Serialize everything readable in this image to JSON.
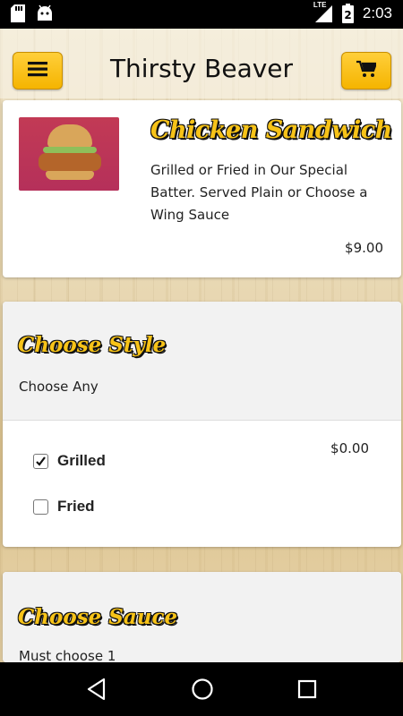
{
  "status_bar": {
    "time": "2:03",
    "battery_level": "2",
    "network": "LTE"
  },
  "app_bar": {
    "title": "Thirsty Beaver",
    "menu_icon": "hamburger-menu-icon",
    "cart_icon": "shopping-cart-icon"
  },
  "product": {
    "name": "Chicken Sandwich",
    "description": "Grilled or Fried in Our Special Batter. Served Plain or Choose a Wing Sauce",
    "price": "$9.00"
  },
  "sections": [
    {
      "title": "Choose Style",
      "subtitle": "Choose Any",
      "options": [
        {
          "label": "Grilled",
          "checked": true,
          "price": "$0.00"
        },
        {
          "label": "Fried",
          "checked": false
        }
      ]
    },
    {
      "title": "Choose Sauce",
      "subtitle": "Must choose 1"
    }
  ],
  "nav_bar": {
    "back_icon": "back-icon",
    "home_icon": "home-icon",
    "recents_icon": "recents-icon"
  },
  "colors": {
    "accent_yellow": "#f7c318",
    "button_yellow": "#ffcf3a"
  }
}
